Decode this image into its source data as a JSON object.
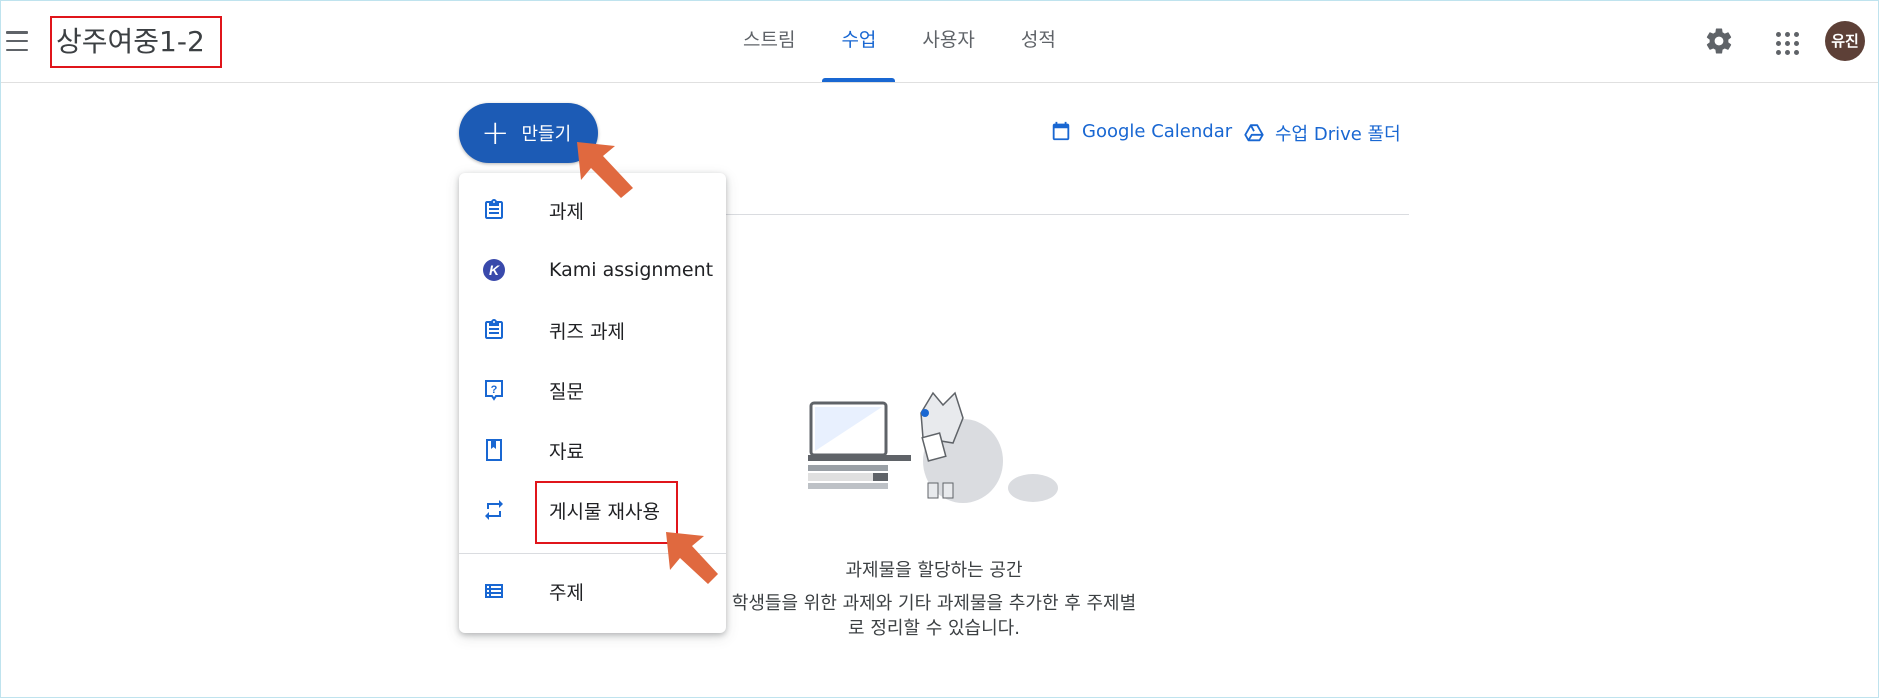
{
  "class_title": "상주여중1-2",
  "tabs": [
    {
      "label": "스트림",
      "active": false
    },
    {
      "label": "수업",
      "active": true
    },
    {
      "label": "사용자",
      "active": false
    },
    {
      "label": "성적",
      "active": false
    }
  ],
  "user": {
    "avatar_text": "유진"
  },
  "create_button": {
    "label": "만들기"
  },
  "links": {
    "calendar": "Google Calendar",
    "drive": "수업 Drive 폴더"
  },
  "create_menu": {
    "items": [
      {
        "label": "과제",
        "icon": "assignment-icon"
      },
      {
        "label": "Kami assignment",
        "icon": "kami-icon"
      },
      {
        "label": "퀴즈 과제",
        "icon": "quiz-assignment-icon"
      },
      {
        "label": "질문",
        "icon": "question-icon"
      },
      {
        "label": "자료",
        "icon": "material-icon"
      },
      {
        "label": "게시물 재사용",
        "icon": "reuse-icon"
      },
      {
        "label": "주제",
        "icon": "topic-icon"
      }
    ]
  },
  "empty_state": {
    "title": "과제물을 할당하는 공간",
    "desc_line1": "학생들을 위한 과제와 기타 과제물을 추가한 후 주제별",
    "desc_line2": "로 정리할 수 있습니다."
  },
  "colors": {
    "accent": "#1967d2",
    "create_button": "#1c5bb5",
    "highlight_box": "#e0151b",
    "pointer_arrow": "#e0693f",
    "avatar": "#5d4037"
  }
}
